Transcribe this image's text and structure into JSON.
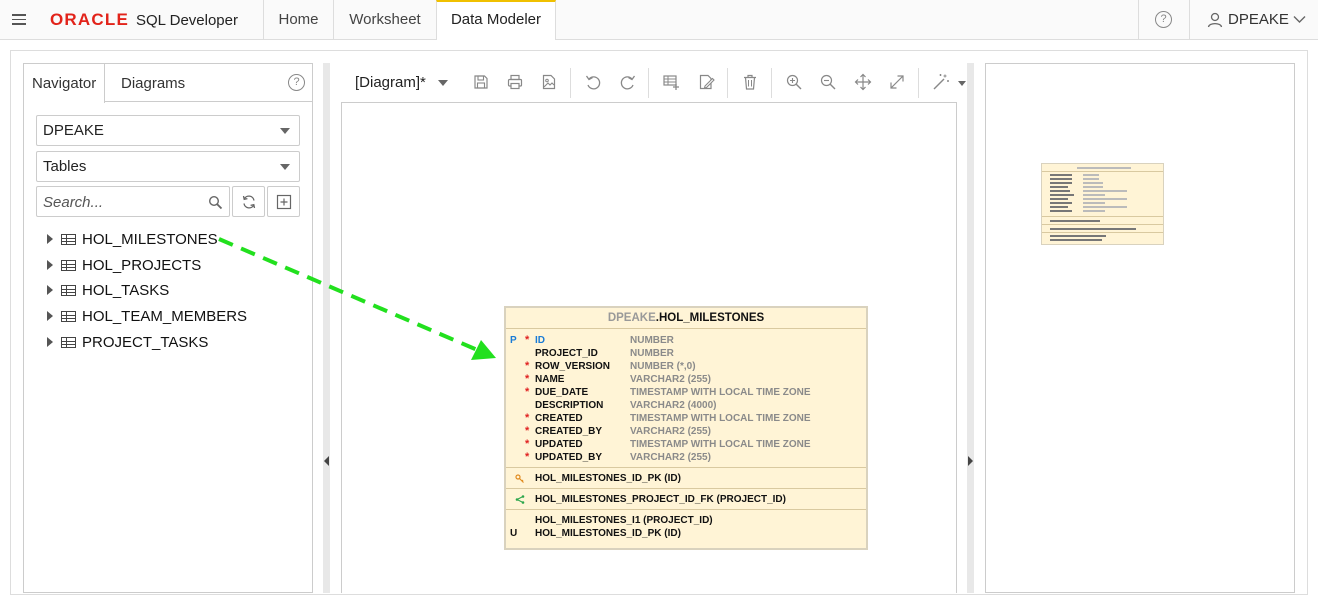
{
  "topbar": {
    "logo_brand": "ORACLE",
    "logo_product": "SQL Developer",
    "tabs": [
      "Home",
      "Worksheet",
      "Data Modeler"
    ],
    "active_tab": "Data Modeler",
    "user": "DPEAKE",
    "help_glyph": "?"
  },
  "navigator": {
    "tabs": [
      "Navigator",
      "Diagrams"
    ],
    "help_glyph": "?",
    "schema": "DPEAKE",
    "object_type": "Tables",
    "search_placeholder": "Search...",
    "tables": [
      "HOL_MILESTONES",
      "HOL_PROJECTS",
      "HOL_TASKS",
      "HOL_TEAM_MEMBERS",
      "PROJECT_TASKS"
    ]
  },
  "toolbar": {
    "diagram_name": "[Diagram]*",
    "icons": [
      "save-icon",
      "print-icon",
      "export-image-icon",
      "undo-icon",
      "redo-icon",
      "add-table-icon",
      "edit-icon",
      "delete-icon",
      "zoom-in-icon",
      "zoom-out-icon",
      "pan-icon",
      "fit-icon",
      "auto-layout-icon"
    ]
  },
  "entity": {
    "schema": "DPEAKE",
    "name": ".HOL_MILESTONES",
    "columns": [
      {
        "flag": "P",
        "required": true,
        "name": "ID",
        "type": "NUMBER"
      },
      {
        "flag": "",
        "required": false,
        "name": "PROJECT_ID",
        "type": "NUMBER"
      },
      {
        "flag": "",
        "required": true,
        "name": "ROW_VERSION",
        "type": "NUMBER (*,0)"
      },
      {
        "flag": "",
        "required": true,
        "name": "NAME",
        "type": "VARCHAR2 (255)"
      },
      {
        "flag": "",
        "required": true,
        "name": "DUE_DATE",
        "type": "TIMESTAMP WITH LOCAL TIME ZONE"
      },
      {
        "flag": "",
        "required": false,
        "name": "DESCRIPTION",
        "type": "VARCHAR2 (4000)"
      },
      {
        "flag": "",
        "required": true,
        "name": "CREATED",
        "type": "TIMESTAMP WITH LOCAL TIME ZONE"
      },
      {
        "flag": "",
        "required": true,
        "name": "CREATED_BY",
        "type": "VARCHAR2 (255)"
      },
      {
        "flag": "",
        "required": true,
        "name": "UPDATED",
        "type": "TIMESTAMP WITH LOCAL TIME ZONE"
      },
      {
        "flag": "",
        "required": true,
        "name": "UPDATED_BY",
        "type": "VARCHAR2 (255)"
      }
    ],
    "primary_key": "HOL_MILESTONES_ID_PK (ID)",
    "foreign_key": "HOL_MILESTONES_PROJECT_ID_FK (PROJECT_ID)",
    "indexes": [
      {
        "flag": "",
        "text": "HOL_MILESTONES_I1 (PROJECT_ID)"
      },
      {
        "flag": "U",
        "text": "HOL_MILESTONES_ID_PK (ID)"
      }
    ]
  },
  "colors": {
    "accent": "#f0c000",
    "oracle_red": "#e2231a",
    "entity_fill": "#fff4d6",
    "drag_arrow": "#22e01e",
    "pk_blue": "#1a7bd6"
  }
}
